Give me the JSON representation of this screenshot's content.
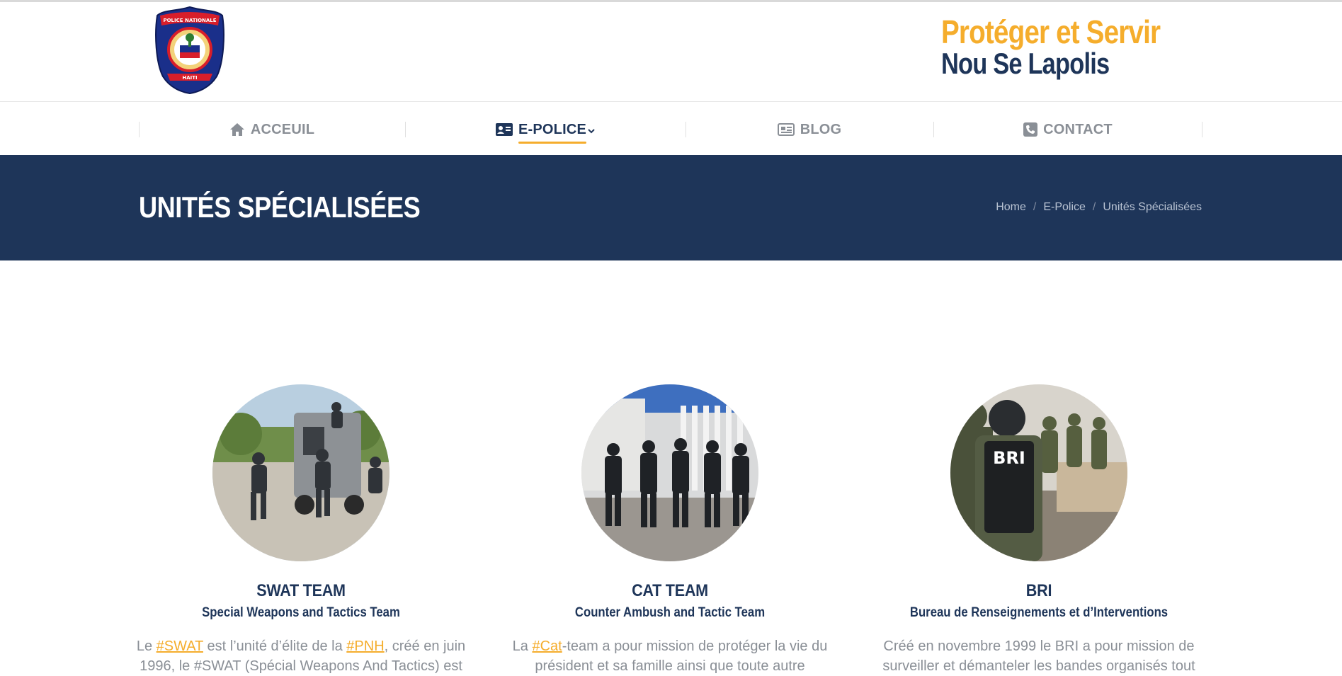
{
  "header": {
    "logo_alt": "Police Nationale d'Haïti",
    "logo_text_top": "POLICE NATIONALE",
    "logo_text_bottom": "HAITI",
    "tagline_line1": "Protéger et Servir",
    "tagline_line2": "Nou Se Lapolis",
    "colors": {
      "navy": "#1e3559",
      "gold": "#f5ad2c"
    }
  },
  "nav": {
    "items": [
      {
        "label": "ACCEUIL",
        "icon": "home-icon"
      },
      {
        "label": "E-POLICE",
        "icon": "id-card-icon",
        "active": true,
        "dropdown": true
      },
      {
        "label": "BLOG",
        "icon": "newspaper-icon"
      },
      {
        "label": "CONTACT",
        "icon": "phone-square-icon"
      }
    ]
  },
  "page": {
    "title": "UNITÉS SPÉCIALISÉES",
    "breadcrumb": [
      "Home",
      "E-Police",
      "Unités Spécialisées"
    ]
  },
  "units": [
    {
      "name": "SWAT TEAM",
      "subtitle": "Special Weapons and Tactics Team",
      "text_pre": "Le ",
      "tag1": "#SWAT",
      "text_mid": " est l’unité d’élite de la ",
      "tag2": "#PNH",
      "text_post": ", créé en juin 1996, le #SWAT (Spécial Weapons And Tactics) est"
    },
    {
      "name": "CAT TEAM",
      "subtitle": "Counter Ambush and Tactic Team",
      "text_pre": "La ",
      "tag1": "#Cat",
      "text_post": "-team a pour mission de protéger la vie du président et sa famille ainsi que toute autre"
    },
    {
      "name": "BRI",
      "subtitle": "Bureau de Renseignements et d’Interventions",
      "text_pre": "Créé en novembre 1999 le BRI a pour mission de surveiller et démanteler les bandes organisés tout"
    }
  ]
}
